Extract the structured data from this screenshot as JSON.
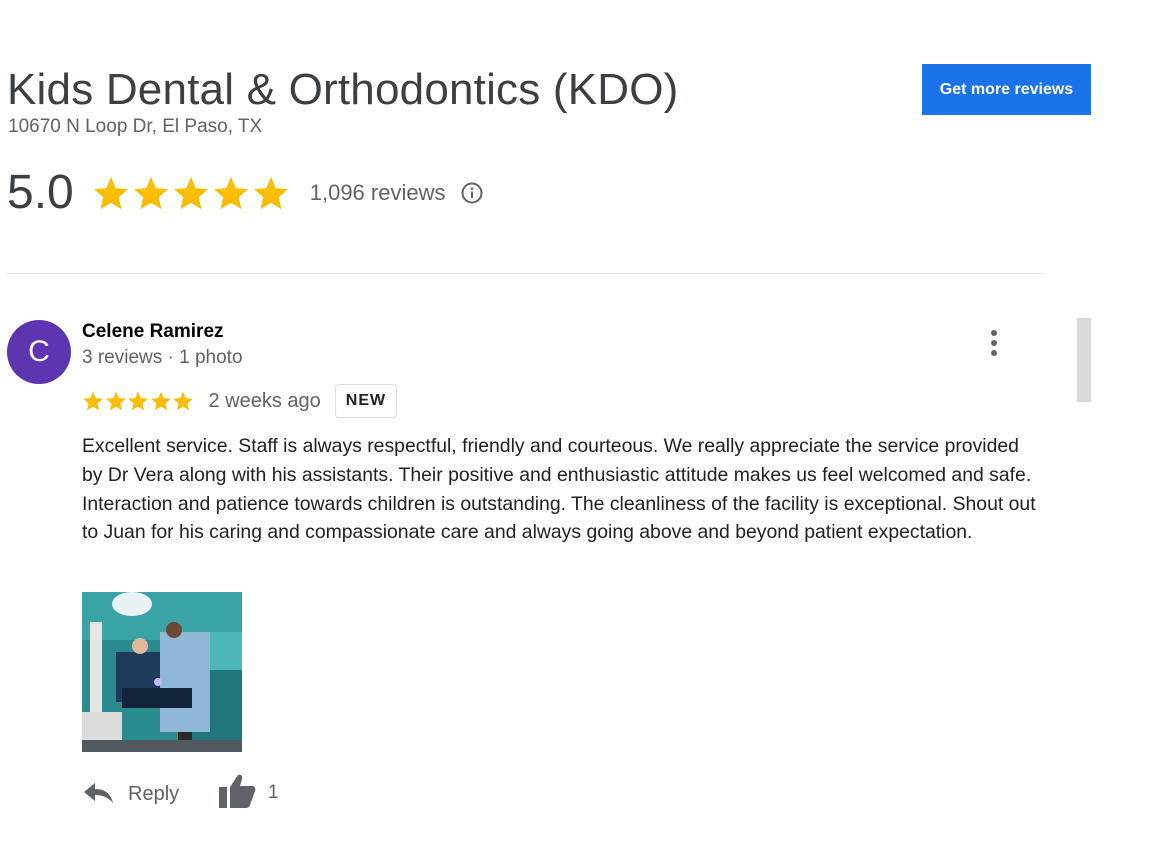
{
  "business": {
    "name": "Kids Dental & Orthodontics (KDO)",
    "address": "10670 N Loop Dr, El Paso, TX",
    "rating": "5.0",
    "rating_value": 5,
    "rating_max": 5,
    "review_count": "1,096 reviews",
    "cta_label": "Get more reviews"
  },
  "review": {
    "avatar_letter": "C",
    "author": "Celene Ramirez",
    "meta": "3 reviews · 1 photo",
    "stars": 5,
    "date": "2 weeks ago",
    "badge": "NEW",
    "text": "Excellent service. Staff is always respectful,  friendly and courteous. We really appreciate the service provided by Dr Vera along with his assistants. Their positive and enthusiastic attitude makes us feel welcomed and safe. Interaction and patience towards children is outstanding. The cleanliness of the facility is exceptional. Shout out to Juan for his caring and compassionate care and always going above and beyond patient expectation.",
    "photo_count": 1,
    "reply_label": "Reply",
    "like_count": "1"
  },
  "icons": {
    "star": "star-icon",
    "info": "info-icon",
    "more": "more-vertical-icon",
    "reply": "reply-icon",
    "like": "thumbs-up-icon"
  },
  "colors": {
    "accent": "#1a73e8",
    "star": "#fbbc04",
    "avatar": "#5e35b1",
    "text_secondary": "#5f6368"
  }
}
